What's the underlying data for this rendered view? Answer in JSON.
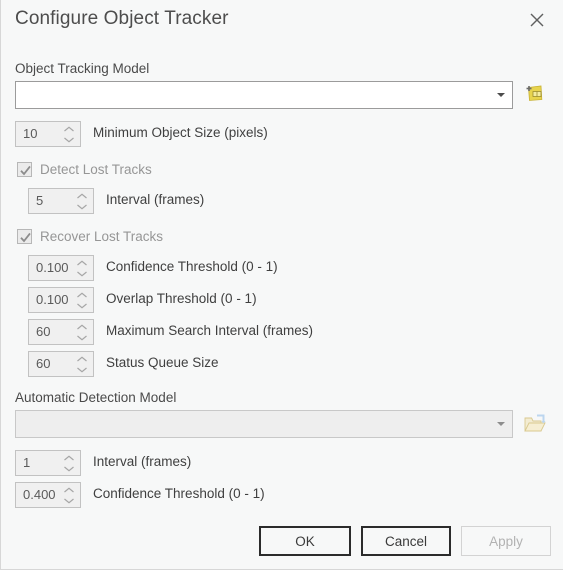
{
  "dialog": {
    "title": "Configure Object Tracker",
    "close_icon": "close-icon"
  },
  "tracking_model": {
    "label": "Object Tracking Model",
    "value": "",
    "placeholder": "",
    "add_icon": "add-model-icon"
  },
  "minimum_object_size": {
    "value": "10",
    "label": "Minimum Object Size (pixels)"
  },
  "detect_lost_tracks": {
    "label": "Detect Lost Tracks",
    "checked": true,
    "enabled": false
  },
  "detect_interval": {
    "value": "5",
    "label": "Interval (frames)"
  },
  "recover_lost_tracks": {
    "label": "Recover Lost Tracks",
    "checked": true,
    "enabled": false
  },
  "recover_fields": [
    {
      "value": "0.100",
      "label": "Confidence Threshold (0 - 1)"
    },
    {
      "value": "0.100",
      "label": "Overlap Threshold (0 - 1)"
    },
    {
      "value": "60",
      "label": "Maximum Search Interval (frames)"
    },
    {
      "value": "60",
      "label": "Status Queue Size"
    }
  ],
  "detection_model": {
    "label": "Automatic Detection Model",
    "value": "",
    "browse_icon": "open-folder-icon"
  },
  "detection_interval": {
    "value": "1",
    "label": "Interval (frames)"
  },
  "detection_confidence": {
    "value": "0.400",
    "label": "Confidence Threshold (0 - 1)"
  },
  "buttons": {
    "ok": "OK",
    "cancel": "Cancel",
    "apply": "Apply"
  },
  "colors": {
    "background": "#f7f8f8",
    "text": "#4a4a4a",
    "disabled_text": "#9a9a9a",
    "accent_yellow": "#e8d44d",
    "folder_yellow": "#f0e2b0",
    "arrow_blue": "#bcd6ef"
  }
}
